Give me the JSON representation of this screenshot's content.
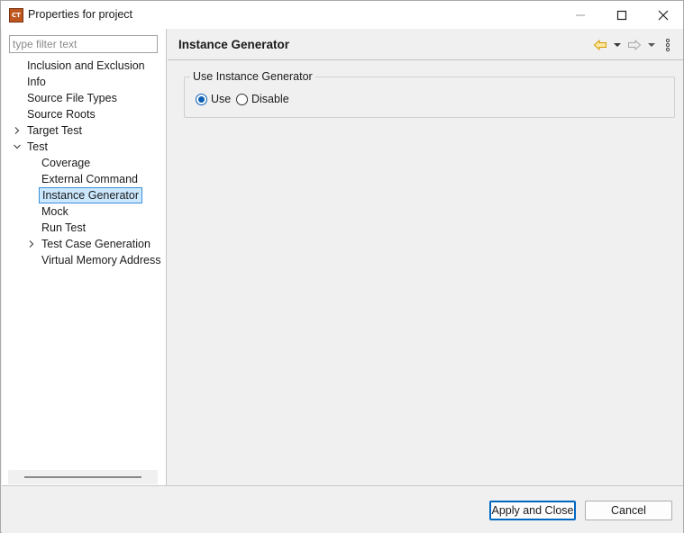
{
  "window": {
    "title": "Properties for project",
    "app_icon_text": "CT"
  },
  "filter": {
    "placeholder": "type filter text",
    "value": ""
  },
  "tree": {
    "items": [
      {
        "label": "Inclusion and Exclusion",
        "level": 0,
        "expander": "none"
      },
      {
        "label": "Info",
        "level": 0,
        "expander": "none"
      },
      {
        "label": "Source File Types",
        "level": 0,
        "expander": "none"
      },
      {
        "label": "Source Roots",
        "level": 0,
        "expander": "none"
      },
      {
        "label": "Target Test",
        "level": 0,
        "expander": "collapsed"
      },
      {
        "label": "Test",
        "level": 0,
        "expander": "expanded"
      },
      {
        "label": "Coverage",
        "level": 1,
        "expander": "none"
      },
      {
        "label": "External Command",
        "level": 1,
        "expander": "none"
      },
      {
        "label": "Instance Generator",
        "level": 1,
        "expander": "none",
        "selected": true
      },
      {
        "label": "Mock",
        "level": 1,
        "expander": "none"
      },
      {
        "label": "Run Test",
        "level": 1,
        "expander": "none"
      },
      {
        "label": "Test Case Generation",
        "level": 1,
        "expander": "collapsed"
      },
      {
        "label": "Virtual Memory Address",
        "level": 1,
        "expander": "none"
      }
    ]
  },
  "page": {
    "title": "Instance Generator",
    "group": {
      "label": "Use Instance Generator",
      "options": [
        {
          "label": "Use",
          "checked": true
        },
        {
          "label": "Disable",
          "checked": false
        }
      ]
    }
  },
  "buttons": {
    "apply_close": "Apply and Close",
    "cancel": "Cancel"
  },
  "colors": {
    "accent": "#0067c0",
    "selection_bg": "#cce8ff",
    "back_arrow": "#e0a800"
  }
}
